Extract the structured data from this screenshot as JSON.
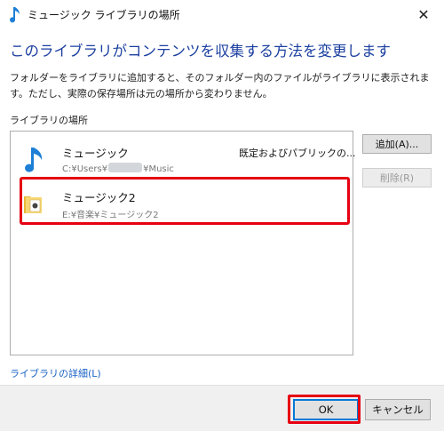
{
  "window": {
    "title": "ミュージック ライブラリの場所",
    "close_label": "✕"
  },
  "heading": "このライブラリがコンテンツを収集する方法を変更します",
  "description": "フォルダーをライブラリに追加すると、そのフォルダー内のファイルがライブラリに表示されます。ただし、実際の保存場所は元の場所から変わりません。",
  "locations_label": "ライブラリの場所",
  "locations": [
    {
      "name": "ミュージック",
      "path_prefix": "C:¥Users¥",
      "path_suffix": "¥Music",
      "meta": "既定およびパブリックの...",
      "icon": "music-note-icon"
    },
    {
      "name": "ミュージック2",
      "path": "E:¥音楽¥ミュージック2",
      "meta": "",
      "icon": "folder-icon"
    }
  ],
  "buttons": {
    "add": "追加(A)...",
    "remove": "削除(R)",
    "ok": "OK",
    "cancel": "キャンセル"
  },
  "details_link": "ライブラリの詳細(L)",
  "colors": {
    "heading": "#1b3fa0",
    "link": "#1a63c6",
    "highlight": "#e60012",
    "music_icon": "#1e7fd6"
  }
}
